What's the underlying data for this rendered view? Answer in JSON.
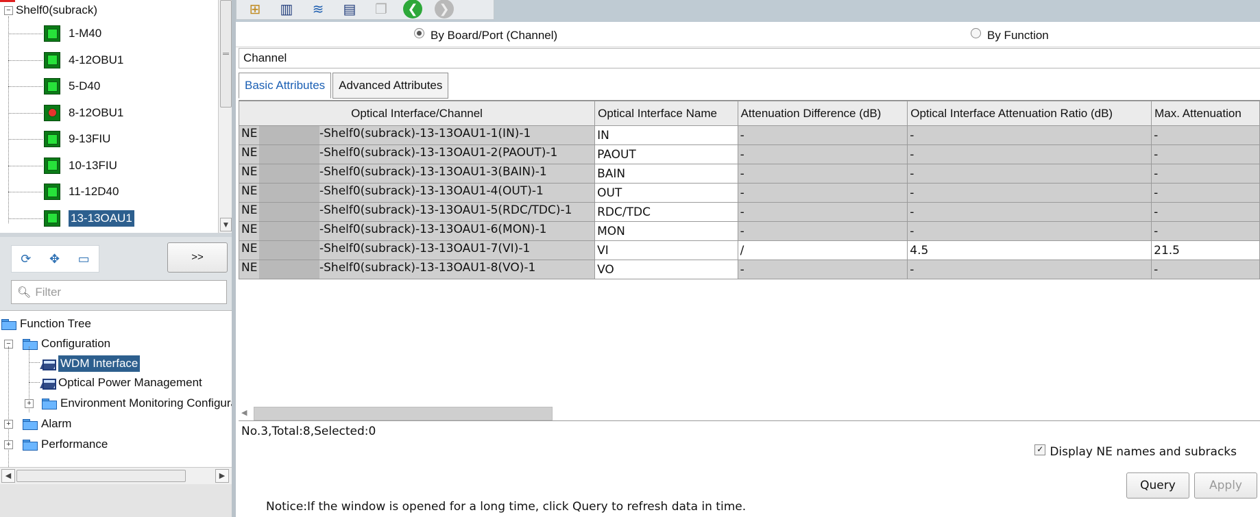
{
  "left": {
    "subrack_tree": {
      "root_label": "Shelf0(subrack)",
      "boards": [
        {
          "label": "1-M40",
          "status": "normal"
        },
        {
          "label": "4-12OBU1",
          "status": "normal"
        },
        {
          "label": "5-D40",
          "status": "normal"
        },
        {
          "label": "8-12OBU1",
          "status": "alarm"
        },
        {
          "label": "9-13FIU",
          "status": "normal"
        },
        {
          "label": "10-13FIU",
          "status": "normal"
        },
        {
          "label": "11-12D40",
          "status": "normal"
        },
        {
          "label": "13-13OAU1",
          "status": "selected"
        }
      ]
    },
    "toolbar": {
      "icons": [
        "refresh-icon",
        "expand-icon",
        "collapse-icon"
      ],
      "more_label": ">>"
    },
    "filter": {
      "placeholder": "Filter"
    },
    "function_tree": {
      "root": "Function Tree",
      "configuration": "Configuration",
      "wdm_interface": "WDM Interface",
      "optical_power": "Optical Power Management",
      "environment": "Environment Monitoring Configuration",
      "alarm": "Alarm",
      "performance": "Performance"
    }
  },
  "right": {
    "toolbar_icons": [
      "add-icon",
      "layout-icon",
      "layers-icon",
      "book-icon",
      "copy-icon",
      "back-icon",
      "forward-icon"
    ],
    "radio": {
      "by_board": "By Board/Port (Channel)",
      "by_function": "By Function",
      "selected": "by_board"
    },
    "channel_label": "Channel",
    "tabs": {
      "basic": "Basic Attributes",
      "advanced": "Advanced Attributes"
    },
    "table": {
      "headers": [
        "Optical Interface/Channel",
        "Optical Interface Name",
        "Attenuation Difference (dB)",
        "Optical Interface Attenuation Ratio (dB)",
        "Max. Attenuation"
      ],
      "rows": [
        {
          "ne": "NE",
          "channel": "-Shelf0(subrack)-13-13OAU1-1(IN)-1",
          "name": "IN",
          "diff": "-",
          "ratio": "-",
          "max": "-"
        },
        {
          "ne": "NE",
          "channel": "-Shelf0(subrack)-13-13OAU1-2(PAOUT)-1",
          "name": "PAOUT",
          "diff": "-",
          "ratio": "-",
          "max": "-"
        },
        {
          "ne": "NE",
          "channel": "-Shelf0(subrack)-13-13OAU1-3(BAIN)-1",
          "name": "BAIN",
          "diff": "-",
          "ratio": "-",
          "max": "-"
        },
        {
          "ne": "NE",
          "channel": "-Shelf0(subrack)-13-13OAU1-4(OUT)-1",
          "name": "OUT",
          "diff": "-",
          "ratio": "-",
          "max": "-"
        },
        {
          "ne": "NE",
          "channel": "-Shelf0(subrack)-13-13OAU1-5(RDC/TDC)-1",
          "name": "RDC/TDC",
          "diff": "-",
          "ratio": "-",
          "max": "-"
        },
        {
          "ne": "NE",
          "channel": "-Shelf0(subrack)-13-13OAU1-6(MON)-1",
          "name": "MON",
          "diff": "-",
          "ratio": "-",
          "max": "-"
        },
        {
          "ne": "NE",
          "channel": "-Shelf0(subrack)-13-13OAU1-7(VI)-1",
          "name": "VI",
          "diff": "/",
          "ratio": "4.5",
          "max": "21.5"
        },
        {
          "ne": "NE",
          "channel": "-Shelf0(subrack)-13-13OAU1-8(VO)-1",
          "name": "VO",
          "diff": "-",
          "ratio": "-",
          "max": "-"
        }
      ]
    },
    "status_text": "No.3,Total:8,Selected:0",
    "display_names_label": "Display NE names and subracks",
    "display_names_checked": true,
    "query_label": "Query",
    "apply_label": "Apply",
    "notice": "Notice:If the window is opened for a long time, click Query to refresh data in time."
  }
}
